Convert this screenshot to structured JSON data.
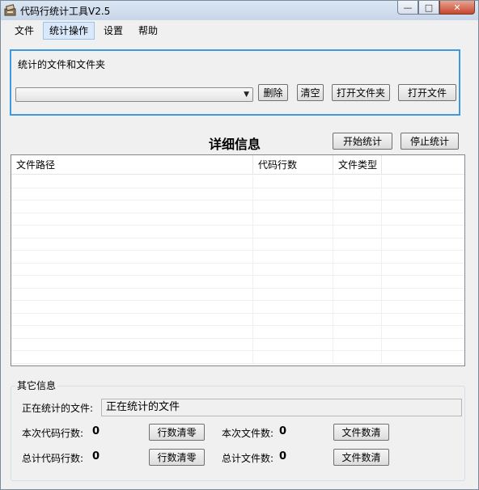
{
  "window": {
    "title": "代码行统计工具V2.5",
    "caption": {
      "minimize": "—",
      "maximize": "□",
      "close": "✕"
    }
  },
  "menu": {
    "items": [
      "文件",
      "统计操作",
      "设置",
      "帮助"
    ],
    "active": "统计操作"
  },
  "stats_files": {
    "group_label": "统计的文件和文件夹",
    "combo_value": "",
    "buttons": {
      "delete": "删除",
      "clear": "清空",
      "open_folder": "打开文件夹",
      "open_file": "打开文件"
    }
  },
  "detail": {
    "title": "详细信息",
    "start_button": "开始统计",
    "stop_button": "停止统计",
    "columns": [
      "文件路径",
      "代码行数",
      "文件类型",
      ""
    ]
  },
  "other_info": {
    "group_label": "其它信息",
    "current_file_label": "正在统计的文件:",
    "current_file_value": "正在统计的文件",
    "this_lines_label": "本次代码行数:",
    "this_lines_value": "0",
    "reset_lines_button": "行数清零",
    "this_files_label": "本次文件数:",
    "this_files_value": "0",
    "reset_files_button": "文件数清",
    "total_lines_label": "总计代码行数:",
    "total_lines_value": "0",
    "reset_total_lines_button": "行数清零",
    "total_files_label": "总计文件数:",
    "total_files_value": "0",
    "reset_total_files_button": "文件数清"
  },
  "colors": {
    "focus_border": "#3e9ae0",
    "menu_active": "#d9e8fa",
    "close_button": "#c8452e"
  }
}
